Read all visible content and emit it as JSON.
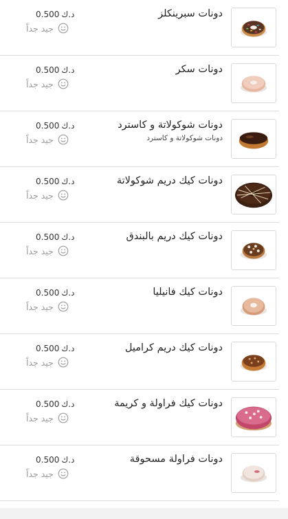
{
  "currency": "د.ك",
  "items": [
    {
      "name": "دونات سبرينكلز",
      "description": "",
      "price": "0.500",
      "rating": "جيد جداً",
      "image": "sprinkle-donut"
    },
    {
      "name": "دونات سكر",
      "description": "",
      "price": "0.500",
      "rating": "جيد جداً",
      "image": "sugar-donut"
    },
    {
      "name": "دونات شوكولاتة و كاسترد",
      "description": "دونات شوكولاتة و كاسترد",
      "price": "0.500",
      "rating": "جيد جداً",
      "image": "chocolate-custard-donut"
    },
    {
      "name": "دونات كيك دريم شوكولاتة",
      "description": "",
      "price": "0.500",
      "rating": "جيد جداً",
      "image": "chocolate-dream-donut"
    },
    {
      "name": "دونات كيك دريم بالبندق",
      "description": "",
      "price": "0.500",
      "rating": "جيد جداً",
      "image": "hazelnut-donut"
    },
    {
      "name": "دونات كيك فانيليا",
      "description": "",
      "price": "0.500",
      "rating": "جيد جداً",
      "image": "vanilla-donut"
    },
    {
      "name": "دونات كيك دريم كراميل",
      "description": "",
      "price": "0.500",
      "rating": "جيد جداً",
      "image": "caramel-donut"
    },
    {
      "name": "دونات كيك فراولة و كريمة",
      "description": "",
      "price": "0.500",
      "rating": "جيد جداً",
      "image": "strawberry-cream-donut"
    },
    {
      "name": "دونات فراولة مسحوقة",
      "description": "",
      "price": "0.500",
      "rating": "جيد جداً",
      "image": "powdered-strawberry-donut"
    }
  ],
  "colors": {
    "divider": "#dcdcdc",
    "rating_text": "#9a9a9a",
    "footer": "#f2f2f2"
  }
}
